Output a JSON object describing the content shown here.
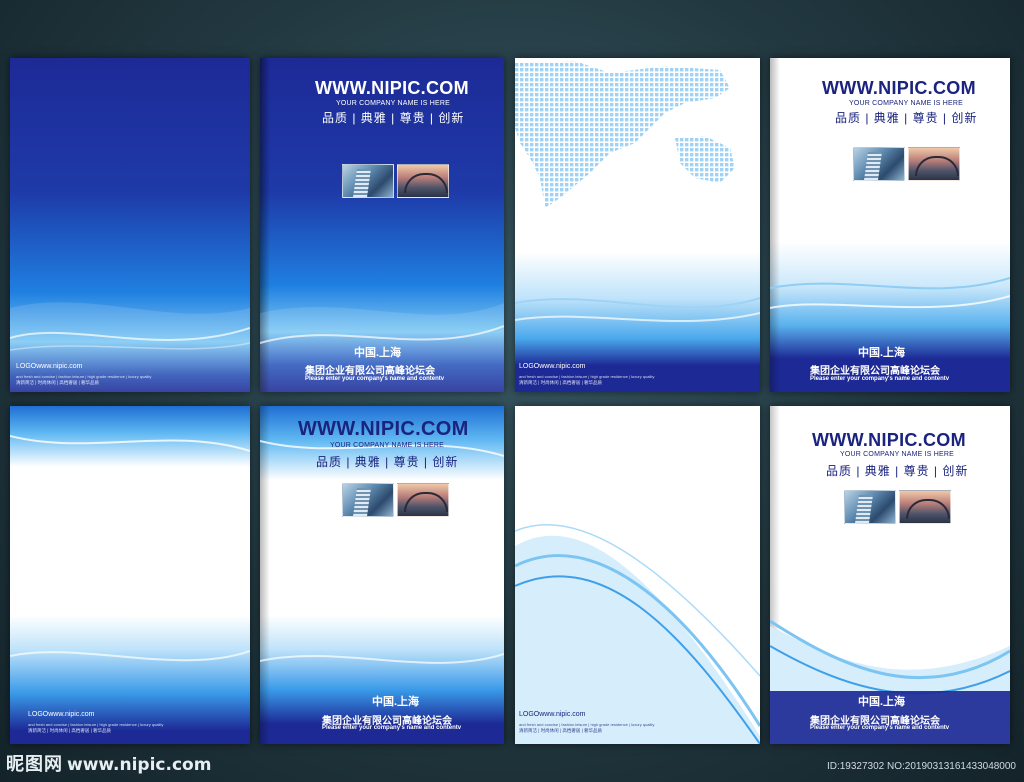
{
  "cover": {
    "url": "WWW.NIPIC.COM",
    "company": "YOUR COMPANY NAME IS HERE",
    "motto": "品质 | 典雅 | 尊贵 | 创新",
    "city": "中国.上海",
    "forum": "集团企业有限公司高峰论坛会",
    "enter": "Please enter your company's name and contentv",
    "logo": "LOGOwww.nipic.com",
    "small_en": "and fresh and concise  |  fashion leisure  |  high grade residence  |  luxury quality",
    "small_cn": "清新简洁 | 时尚休闲 | 高档奢居 | 奢华品质"
  },
  "colors": {
    "navy": "#1c2a9a",
    "blue": "#1e6fd6",
    "light": "#6fc3f2",
    "text_dark": "#1a237e"
  },
  "watermark": {
    "site_cn": "昵图网",
    "site_url": "www.nipic.com",
    "id_text": "ID:19327302 NO:20190313161433048000"
  }
}
